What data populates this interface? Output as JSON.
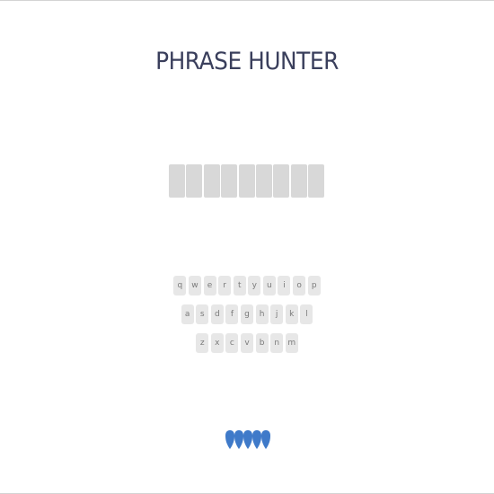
{
  "game": {
    "title": "PHRASE HUNTER"
  },
  "phrase": {
    "tile_count": 9
  },
  "keyboard": {
    "rows": [
      [
        "q",
        "w",
        "e",
        "r",
        "t",
        "y",
        "u",
        "i",
        "o",
        "p"
      ],
      [
        "a",
        "s",
        "d",
        "f",
        "g",
        "h",
        "j",
        "k",
        "l"
      ],
      [
        "z",
        "x",
        "c",
        "v",
        "b",
        "n",
        "m"
      ]
    ]
  },
  "lives": {
    "count": 5,
    "icon": "heart-icon",
    "color": "#3f7ac9"
  },
  "colors": {
    "title": "#3a3f5c",
    "tile": "#d8d8d8",
    "key": "#e7e7e7",
    "key_text": "#7a7a7a"
  }
}
